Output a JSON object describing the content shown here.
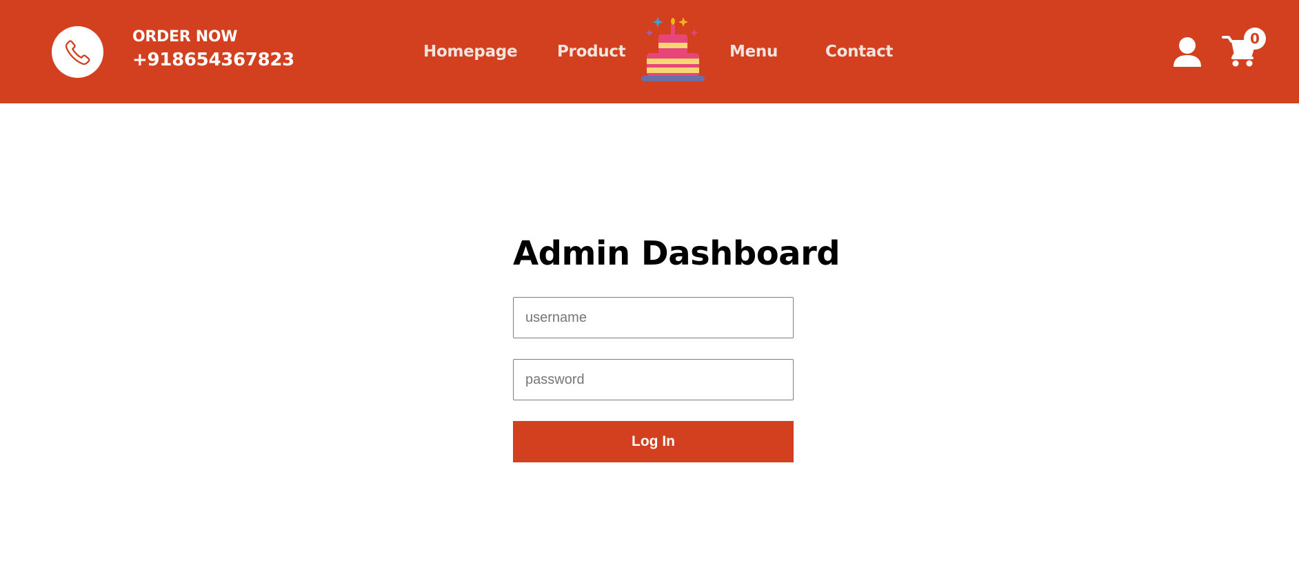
{
  "header": {
    "order_label": "ORDER NOW",
    "phone_number": "+918654367823",
    "nav": {
      "homepage": "Homepage",
      "product": "Product",
      "menu": "Menu",
      "contact": "Contact"
    },
    "cart_count": "0",
    "icons": {
      "phone": "phone-icon",
      "logo": "cake-logo-icon",
      "user": "user-icon",
      "cart": "cart-icon"
    }
  },
  "login": {
    "title": "Admin Dashboard",
    "username_placeholder": "username",
    "password_placeholder": "password",
    "submit_label": "Log In"
  },
  "colors": {
    "brand": "#d3401f",
    "background": "#ffffff",
    "text": "#000000"
  }
}
